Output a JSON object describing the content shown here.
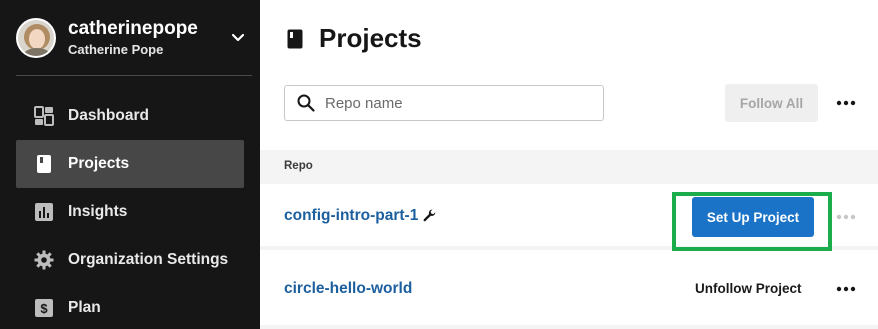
{
  "user": {
    "username": "catherinepope",
    "full_name": "Catherine Pope"
  },
  "sidebar": {
    "items": [
      {
        "label": "Dashboard",
        "icon": "dashboard-icon",
        "active": false
      },
      {
        "label": "Projects",
        "icon": "book-icon",
        "active": true
      },
      {
        "label": "Insights",
        "icon": "bar-chart-icon",
        "active": false
      },
      {
        "label": "Organization Settings",
        "icon": "gear-icon",
        "active": false
      },
      {
        "label": "Plan",
        "icon": "dollar-icon",
        "active": false
      }
    ]
  },
  "page": {
    "title": "Projects",
    "title_icon": "book-icon"
  },
  "search": {
    "placeholder": "Repo name",
    "value": ""
  },
  "toolbar": {
    "follow_all_label": "Follow All"
  },
  "table": {
    "column_header": "Repo",
    "rows": [
      {
        "repo": "config-intro-part-1",
        "has_wrench_icon": true,
        "action_label": "Set Up Project",
        "action_style": "primary",
        "highlighted": true
      },
      {
        "repo": "circle-hello-world",
        "has_wrench_icon": false,
        "action_label": "Unfollow Project",
        "action_style": "text",
        "highlighted": false
      }
    ]
  },
  "colors": {
    "sidebar_bg": "#161616",
    "sidebar_active": "#474747",
    "link": "#1b5f9e",
    "primary_button": "#1a73c7",
    "highlight_border": "#1bac4b"
  }
}
